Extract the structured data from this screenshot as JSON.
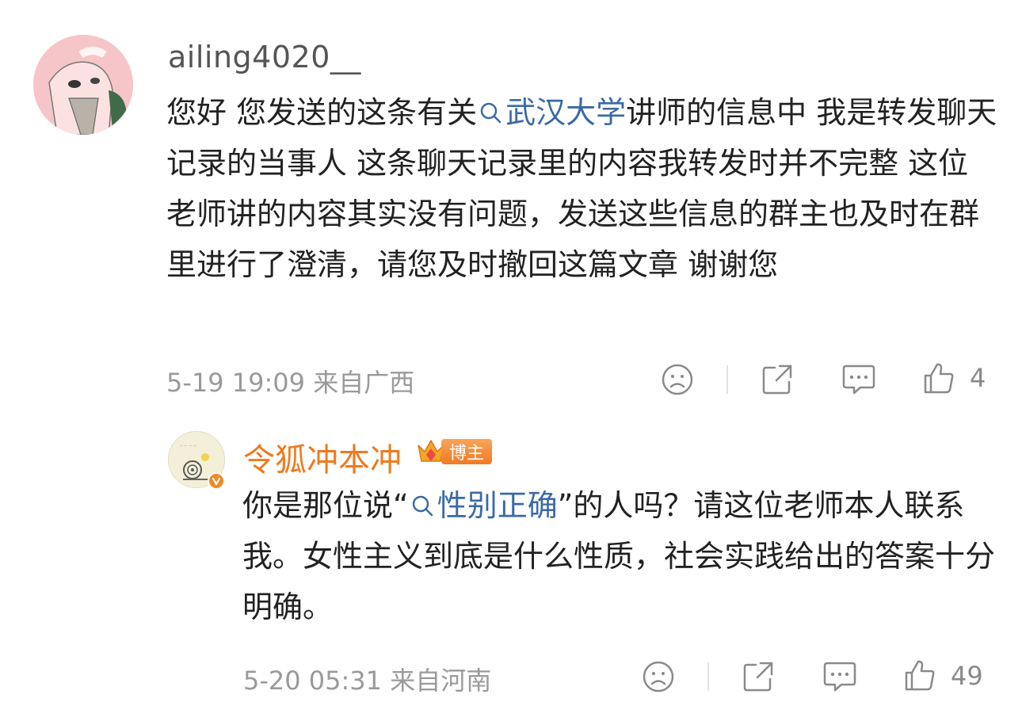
{
  "comment1": {
    "username": "ailing4020__",
    "text_before": "您好 您发送的这条有关",
    "topic": "武汉大学",
    "text_after": "讲师的信息中 我是转发聊天记录的当事人  这条聊天记录里的内容我转发时并不完整  这位老师讲的内容其实没有问题，发送这些信息的群主也及时在群里进行了澄清，请您及时撤回这篇文章 谢谢您",
    "time": "5-19 19:09",
    "location": "来自广西",
    "likes": "4"
  },
  "comment2": {
    "username": "令狐冲本冲",
    "badge_label": "博主",
    "text_before": "你是那位说“",
    "topic": "性别正确",
    "text_after": "”的人吗？请这位老师本人联系我。女性主义到底是什么性质，社会实践给出的答案十分明确。",
    "time": "5-20 05:31",
    "location": "来自河南",
    "likes": "49"
  },
  "colors": {
    "topic_link": "#3b6aa5",
    "blogger_name": "#ef7a1e",
    "meta_text": "#9a9a9a",
    "body_text": "#222222"
  },
  "icons": [
    "dislike-face-icon",
    "share-icon",
    "comment-icon",
    "like-thumb-icon",
    "search-icon",
    "crown-icon",
    "verified-badge-icon"
  ]
}
